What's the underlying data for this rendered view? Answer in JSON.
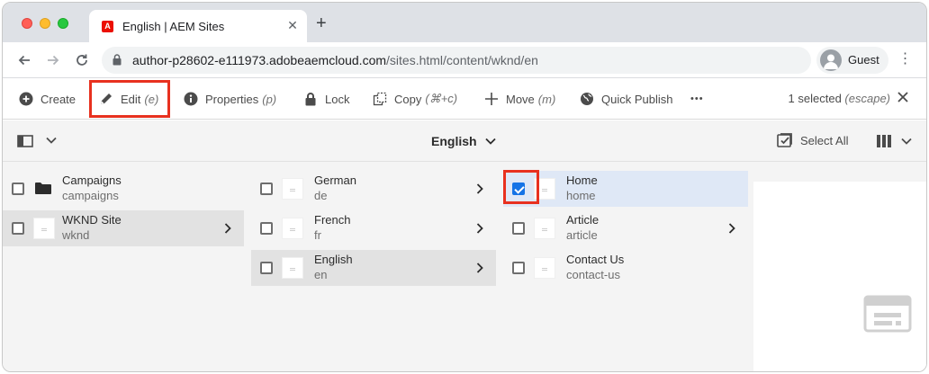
{
  "browser": {
    "tab_title": "English | AEM Sites",
    "url_host": "author-p28602-e111973.adobeaemcloud.com",
    "url_path": "/sites.html/content/wknd/en",
    "profile_name": "Guest"
  },
  "actionbar": {
    "create": "Create",
    "edit": "Edit",
    "edit_shortcut": "(e)",
    "properties": "Properties",
    "properties_shortcut": "(p)",
    "lock": "Lock",
    "copy": "Copy",
    "copy_shortcut": "(⌘+c)",
    "move": "Move",
    "move_shortcut": "(m)",
    "quick_publish": "Quick Publish",
    "more": "•••",
    "selected": "1 selected",
    "selected_shortcut": "(escape)"
  },
  "colbar": {
    "title": "English",
    "select_all": "Select All"
  },
  "columns": [
    {
      "items": [
        {
          "title": "Campaigns",
          "name": "campaigns",
          "icon": "folder-icon",
          "has_children": false,
          "state": "normal"
        },
        {
          "title": "WKND Site",
          "name": "wknd",
          "icon": "page-thumbnail",
          "has_children": true,
          "state": "active"
        }
      ]
    },
    {
      "items": [
        {
          "title": "German",
          "name": "de",
          "icon": "page-thumbnail",
          "has_children": true,
          "state": "normal"
        },
        {
          "title": "French",
          "name": "fr",
          "icon": "page-thumbnail",
          "has_children": true,
          "state": "normal"
        },
        {
          "title": "English",
          "name": "en",
          "icon": "page-thumbnail",
          "has_children": true,
          "state": "active"
        }
      ]
    },
    {
      "items": [
        {
          "title": "Home",
          "name": "home",
          "icon": "page-thumbnail",
          "has_children": false,
          "state": "checked"
        },
        {
          "title": "Article",
          "name": "article",
          "icon": "page-thumbnail",
          "has_children": true,
          "state": "normal"
        },
        {
          "title": "Contact Us",
          "name": "contact-us",
          "icon": "page-thumbnail",
          "has_children": false,
          "state": "normal"
        }
      ]
    }
  ],
  "colors": {
    "highlight": "#e8311f",
    "checkbox_checked": "#1473e6",
    "checked_row": "#dfe8f6",
    "active_row": "#e2e2e2"
  }
}
